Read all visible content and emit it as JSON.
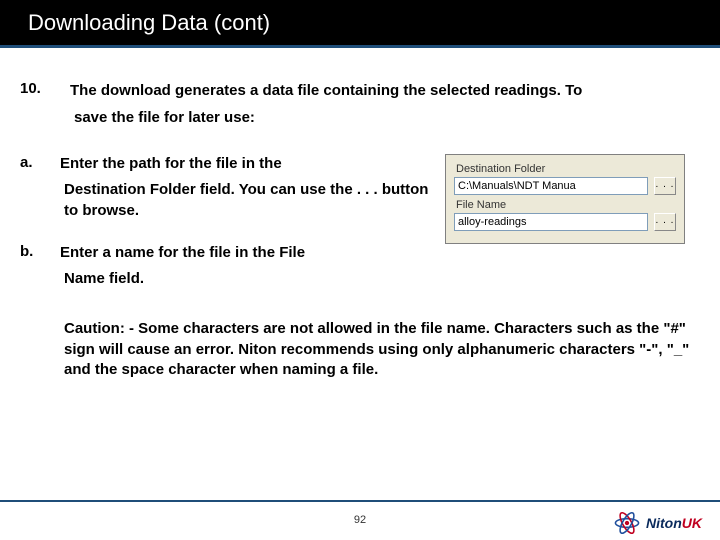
{
  "title": "Downloading Data (cont)",
  "step10": {
    "num": "10.",
    "line1": "The download generates a data file containing the selected readings. To",
    "line2": "save the file for later use:"
  },
  "a": {
    "letter": "a.",
    "line1": "Enter the path for the file in the",
    "cont": "Destination Folder field. You can use the . . . button to browse."
  },
  "b": {
    "letter": "b.",
    "line1": "Enter a name for the file in the File",
    "cont": "Name field."
  },
  "caution": "Caution: - Some characters are not allowed in the file name. Characters such as the \"#\" sign will cause an error. Niton recommends using only alphanumeric characters \"-\", \"_\" and the space character when naming a file.",
  "dialog": {
    "dest_label": "Destination Folder",
    "dest_value": "C:\\Manuals\\NDT Manua",
    "file_label": "File Name",
    "file_value": "alloy-readings",
    "browse": ". . ."
  },
  "page_number": "92",
  "logo": {
    "brand": "Niton",
    "suffix": "UK"
  }
}
